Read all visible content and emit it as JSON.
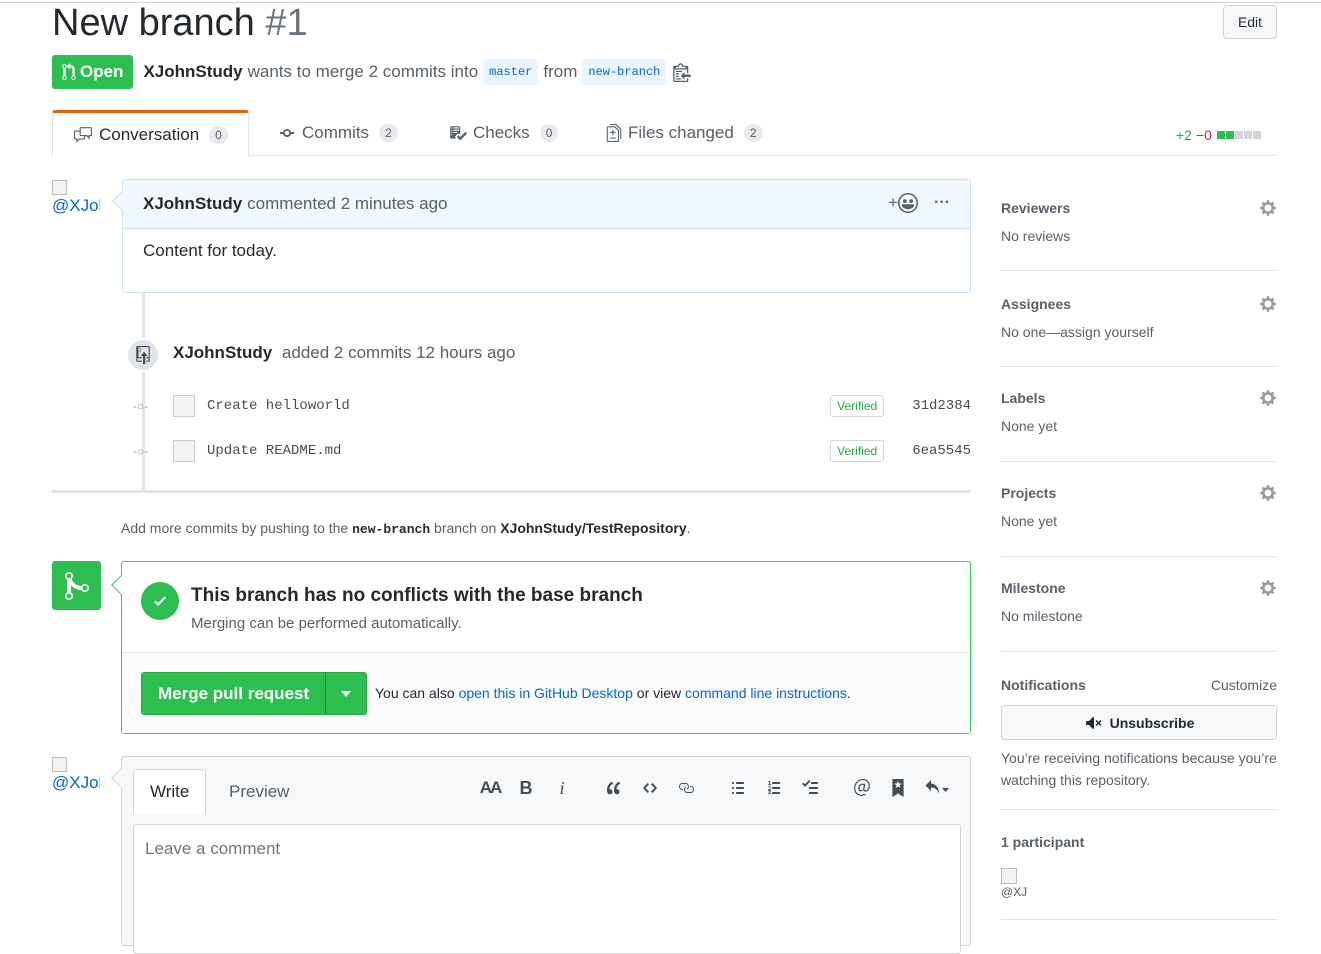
{
  "pr": {
    "title": "New branch",
    "number": "#1",
    "edit_label": "Edit",
    "state": "Open",
    "author": "XJohnStudy",
    "merge_text": "wants to merge 2 commits into",
    "base_branch": "master",
    "from_text": "from",
    "head_branch": "new-branch"
  },
  "tabs": [
    {
      "label": "Conversation",
      "count": "0"
    },
    {
      "label": "Commits",
      "count": "2"
    },
    {
      "label": "Checks",
      "count": "0"
    },
    {
      "label": "Files changed",
      "count": "2"
    }
  ],
  "diffstat": {
    "additions": "+2",
    "deletions": "−0"
  },
  "avatar_alt": "@XJohnStudy",
  "comment": {
    "author": "XJohnStudy",
    "action": "commented 2 minutes ago",
    "reaction_label": "+",
    "more_label": "···",
    "body": "Content for today."
  },
  "commit_event": {
    "author": "XJohnStudy",
    "text": "added 2 commits 12 hours ago",
    "commits": [
      {
        "message": "Create helloworld",
        "verified": "Verified",
        "sha": "31d2384"
      },
      {
        "message": "Update README.md",
        "verified": "Verified",
        "sha": "6ea5545"
      }
    ]
  },
  "push_hint": {
    "prefix": "Add more commits by pushing to the",
    "branch": "new-branch",
    "middle": "branch on",
    "repo": "XJohnStudy/TestRepository",
    "suffix": "."
  },
  "merge": {
    "title": "This branch has no conflicts with the base branch",
    "subtitle": "Merging can be performed automatically.",
    "button": "Merge pull request",
    "alt_prefix": "You can also",
    "alt_link1": "open this in GitHub Desktop",
    "alt_middle": "or view",
    "alt_link2": "command line instructions",
    "alt_suffix": "."
  },
  "editor": {
    "tab_write": "Write",
    "tab_preview": "Preview",
    "toolbar": {
      "heading": "AA",
      "bold": "B",
      "italic": "i"
    },
    "placeholder": "Leave a comment"
  },
  "sidebar": {
    "reviewers": {
      "title": "Reviewers",
      "value": "No reviews"
    },
    "assignees": {
      "title": "Assignees",
      "value": "No one—assign yourself"
    },
    "labels": {
      "title": "Labels",
      "value": "None yet"
    },
    "projects": {
      "title": "Projects",
      "value": "None yet"
    },
    "milestone": {
      "title": "Milestone",
      "value": "No milestone"
    },
    "notifications": {
      "title": "Notifications",
      "customize": "Customize",
      "unsubscribe": "Unsubscribe",
      "reason": "You’re receiving notifications because you’re watching this repository."
    },
    "participants": {
      "title": "1 participant",
      "avatar_alt": "@XJ"
    }
  },
  "colors": {
    "open_green": "#2cbe4e",
    "link_blue": "#0366d6",
    "tab_accent": "#e36209",
    "deletion_red": "#cb2431"
  }
}
